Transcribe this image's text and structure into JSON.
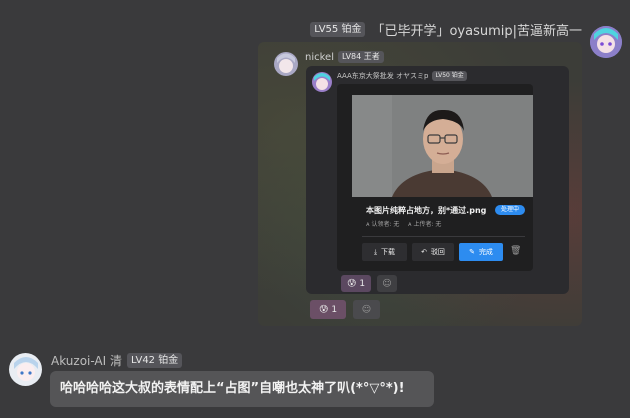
{
  "top_message": {
    "level_badge": "LV55 铂金",
    "text": "「已毕开学」oyasumip|苦逼新高一"
  },
  "nickel": {
    "name": "nickel",
    "level_badge": "LV84 王者"
  },
  "inner_sender": {
    "name": "AAA东京大祭批发 オヤスミp",
    "level_badge": "LV50 铂金"
  },
  "image_card": {
    "caption": "本图片纯粹占地方，别*通过.png",
    "status_badge": "处理中",
    "meta_left": "认领者: 无",
    "meta_right": "上传者: 无",
    "buttons": {
      "download": "下载",
      "reject": "驳回",
      "complete": "完成"
    }
  },
  "inner_reactions": {
    "count": "1"
  },
  "outer_reactions": {
    "count": "1"
  },
  "bot_message": {
    "name": "Akuzoi-AI 清",
    "level_badge": "LV42 铂金",
    "text": "哈哈哈哈这大叔的表情配上“占图”自嘲也太神了叭(*°▽°*)!"
  },
  "colors": {
    "complete_button": "#2d8cf0",
    "status_badge": "#2d8cf0",
    "reaction_active": "#6b4f66"
  }
}
